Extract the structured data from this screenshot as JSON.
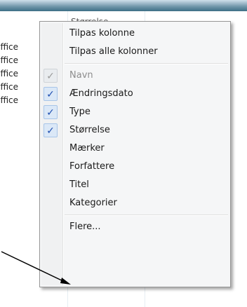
{
  "background": {
    "column_header": "Størrelse",
    "rows": [
      "Office",
      "Office",
      "Office",
      "Office",
      "Office"
    ]
  },
  "menu": {
    "top_items": [
      {
        "label": "Tilpas kolonne"
      },
      {
        "label": "Tilpas alle kolonner"
      }
    ],
    "column_items": [
      {
        "label": "Navn",
        "checked": true,
        "disabled": true
      },
      {
        "label": "Ændringsdato",
        "checked": true,
        "disabled": false
      },
      {
        "label": "Type",
        "checked": true,
        "disabled": false
      },
      {
        "label": "Størrelse",
        "checked": true,
        "disabled": false
      },
      {
        "label": "Mærker",
        "checked": false,
        "disabled": false
      },
      {
        "label": "Forfattere",
        "checked": false,
        "disabled": false
      },
      {
        "label": "Titel",
        "checked": false,
        "disabled": false
      },
      {
        "label": "Kategorier",
        "checked": false,
        "disabled": false
      }
    ],
    "more_label": "Flere...",
    "check_glyph": "✓"
  },
  "colors": {
    "check_active": "#1f4fb0",
    "check_disabled": "#9a9a9a",
    "menu_background": "#f5f6f7"
  }
}
